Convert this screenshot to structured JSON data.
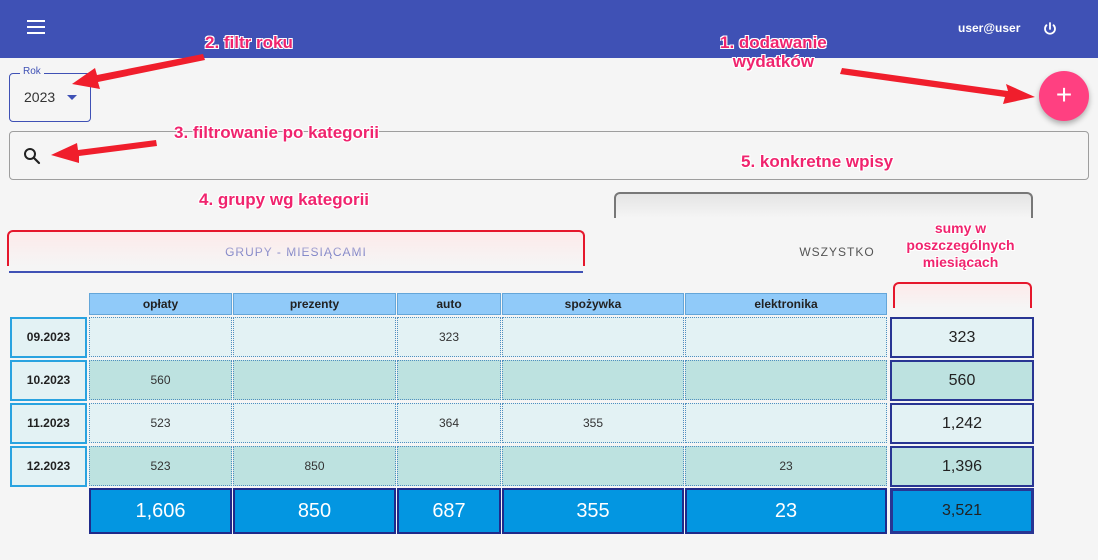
{
  "app": {
    "user": "user@user"
  },
  "year_filter": {
    "label": "Rok",
    "value": "2023"
  },
  "search": {
    "placeholder": ""
  },
  "tabs": {
    "groups": "GRUPY - MIESIĄCAMI",
    "all": "WSZYSTKO"
  },
  "annotations": {
    "add": "1. dodawanie\nwydatków",
    "year": "2. filtr roku",
    "filter": "3. filtrowanie po kategorii",
    "groups": "4. grupy wg kategorii",
    "entries": "5. konkretne wpisy",
    "sums": "sumy w\nposzczególnych\nmiesiącach"
  },
  "table": {
    "columns": [
      "opłaty",
      "prezenty",
      "auto",
      "spożywka",
      "elektronika"
    ],
    "rows": [
      {
        "month": "09.2023",
        "values": [
          "",
          "",
          "323",
          "",
          ""
        ],
        "sum": "323"
      },
      {
        "month": "10.2023",
        "values": [
          "560",
          "",
          "",
          "",
          ""
        ],
        "sum": "560"
      },
      {
        "month": "11.2023",
        "values": [
          "523",
          "",
          "364",
          "355",
          ""
        ],
        "sum": "1,242"
      },
      {
        "month": "12.2023",
        "values": [
          "523",
          "850",
          "",
          "",
          "23"
        ],
        "sum": "1,396"
      }
    ],
    "totals": [
      "1,606",
      "850",
      "687",
      "355",
      "23"
    ],
    "grand_total": "3,521"
  },
  "colors": {
    "primary": "#3f51b5",
    "accent": "#ff4081",
    "annotation": "#f0246e",
    "header": "#90caf9",
    "total": "#0396e1"
  },
  "icons": [
    "menu-icon",
    "power-icon",
    "add-icon",
    "search-icon",
    "dropdown-caret-icon"
  ]
}
